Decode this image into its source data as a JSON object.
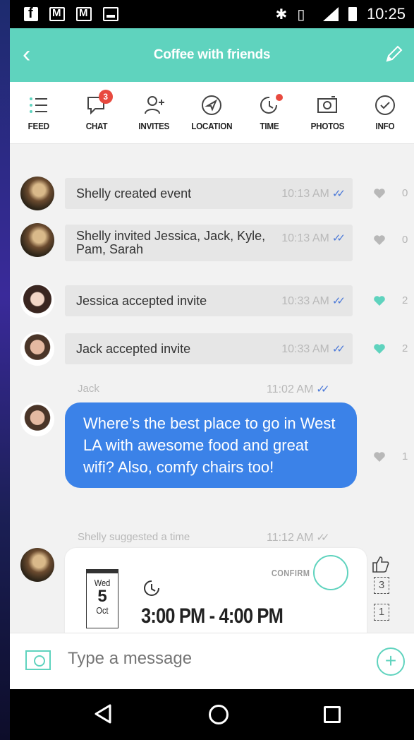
{
  "status_bar": {
    "time": "10:25",
    "network": "LTE"
  },
  "header": {
    "title": "Coffee with friends"
  },
  "tabs": [
    {
      "label": "FEED",
      "icon": "list-icon"
    },
    {
      "label": "CHAT",
      "icon": "chat-icon",
      "badge": "3"
    },
    {
      "label": "INVITES",
      "icon": "add-person-icon"
    },
    {
      "label": "LOCATION",
      "icon": "navigation-icon"
    },
    {
      "label": "TIME",
      "icon": "clock-icon"
    },
    {
      "label": "PHOTOS",
      "icon": "camera-icon"
    },
    {
      "label": "INFO",
      "icon": "check-circle-icon"
    }
  ],
  "feed": {
    "events": [
      {
        "text": "Shelly created event",
        "time": "10:13 AM",
        "likes": "0",
        "liked": false
      },
      {
        "text": "Shelly invited Jessica, Jack, Kyle, Pam, Sarah",
        "time": "10:13 AM",
        "likes": "0",
        "liked": false
      },
      {
        "text": "Jessica accepted invite",
        "time": "10:33 AM",
        "likes": "2",
        "liked": true
      },
      {
        "text": "Jack accepted invite",
        "time": "10:33 AM",
        "likes": "2",
        "liked": true
      }
    ],
    "message": {
      "sender": "Jack",
      "time": "11:02 AM",
      "text": "Where’s the best place to go in West LA with awesome food and great wifi? Also, comfy chairs too!",
      "likes": "1"
    },
    "suggestion": {
      "caption": "Shelly suggested a time",
      "time": "11:12 AM",
      "weekday": "Wed",
      "day": "5",
      "month": "Oct",
      "range": "3:00 PM - 4:00 PM",
      "confirm_label": "CONFIRM",
      "votes_up": "3",
      "votes_other": "1"
    }
  },
  "compose": {
    "placeholder": "Type a message"
  },
  "colors": {
    "accent": "#5fd3be",
    "bubble": "#3b82e8",
    "badge": "#e84a3f",
    "ticks": "#4a78d8"
  }
}
